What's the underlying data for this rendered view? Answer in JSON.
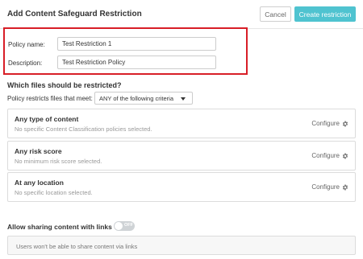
{
  "header": {
    "title": "Add Content Safeguard Restriction",
    "cancel_label": "Cancel",
    "create_label": "Create restriction",
    "accent_color": "#4fc3d0"
  },
  "form": {
    "policy_name_label": "Policy name:",
    "policy_name_value": "Test Restriction 1",
    "description_label": "Description:",
    "description_value": "Test Restriction Policy",
    "highlight_color": "#d81e27"
  },
  "criteria": {
    "heading": "Which files should be restricted?",
    "label": "Policy restricts files that meet:",
    "selected": "ANY of the following criteria"
  },
  "cards": [
    {
      "title": "Any type of content",
      "subtitle": "No specific Content Classification policies selected.",
      "action": "Configure"
    },
    {
      "title": "Any risk score",
      "subtitle": "No minimum risk score selected.",
      "action": "Configure"
    },
    {
      "title": "At any location",
      "subtitle": "No specific location selected.",
      "action": "Configure"
    }
  ],
  "sharing": {
    "label": "Allow sharing content with links",
    "toggle_text": "OFF",
    "toggle_on": false,
    "info": "Users won't be able to share content via links"
  },
  "icons": {
    "configure": "gear-icon",
    "dropdown": "caret-down-icon"
  }
}
